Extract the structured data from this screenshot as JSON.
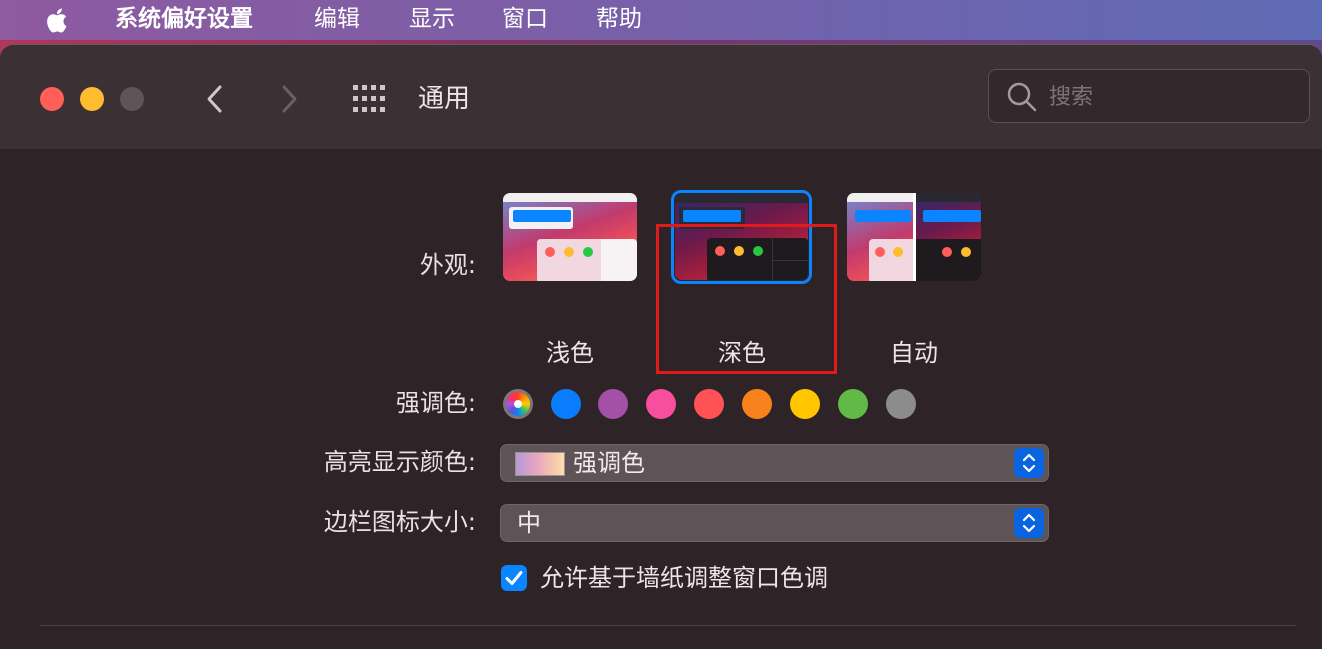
{
  "menubar": {
    "app_name": "系统偏好设置",
    "items": [
      "编辑",
      "显示",
      "窗口",
      "帮助"
    ]
  },
  "window": {
    "title": "通用",
    "search_placeholder": "搜索"
  },
  "appearance": {
    "label": "外观:",
    "options": [
      {
        "label": "浅色",
        "selected": false
      },
      {
        "label": "深色",
        "selected": true
      },
      {
        "label": "自动",
        "selected": false
      }
    ]
  },
  "accent": {
    "label": "强调色:",
    "colors": [
      "multicolor",
      "#0a7dff",
      "#a550a7",
      "#f74f9e",
      "#ff5257",
      "#f7821b",
      "#ffc600",
      "#62ba46",
      "#8c8c8c"
    ]
  },
  "highlight": {
    "label": "高亮显示颜色:",
    "value": "强调色"
  },
  "sidebar_icon": {
    "label": "边栏图标大小:",
    "value": "中"
  },
  "wallpaper_tint": {
    "label": "允许基于墙纸调整窗口色调",
    "checked": true
  },
  "colors": {
    "accent_blue": "#0a84ff",
    "annotation_red": "#e11b1b"
  }
}
